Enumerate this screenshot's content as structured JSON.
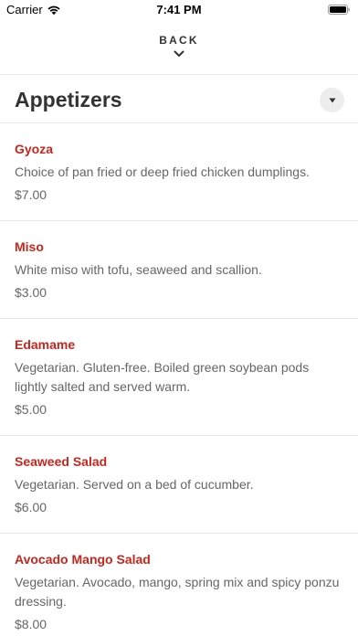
{
  "status_bar": {
    "carrier": "Carrier",
    "time": "7:41 PM"
  },
  "nav": {
    "back_label": "BACK"
  },
  "section": {
    "title": "Appetizers"
  },
  "items": [
    {
      "name": "Gyoza",
      "description": "Choice of pan fried or deep fried chicken dumplings.",
      "price": "$7.00"
    },
    {
      "name": "Miso",
      "description": "White miso with tofu, seaweed and scallion.",
      "price": "$3.00"
    },
    {
      "name": "Edamame",
      "description": "Vegetarian. Gluten-free. Boiled green soybean pods lightly salted and served warm.",
      "price": "$5.00"
    },
    {
      "name": "Seaweed Salad",
      "description": "Vegetarian. Served on a bed of cucumber.",
      "price": "$6.00"
    },
    {
      "name": "Avocado Mango Salad",
      "description": "Vegetarian. Avocado, mango, spring mix and spicy ponzu dressing.",
      "price": "$8.00"
    }
  ],
  "colors": {
    "item_name": "#c8261c",
    "text": "#333333",
    "muted": "#666666",
    "divider": "#e6e6e6"
  },
  "icons": {
    "wifi": "wifi-icon",
    "battery": "battery-icon",
    "back": "chevron-down-icon",
    "section_toggle": "triangle-down-icon"
  }
}
